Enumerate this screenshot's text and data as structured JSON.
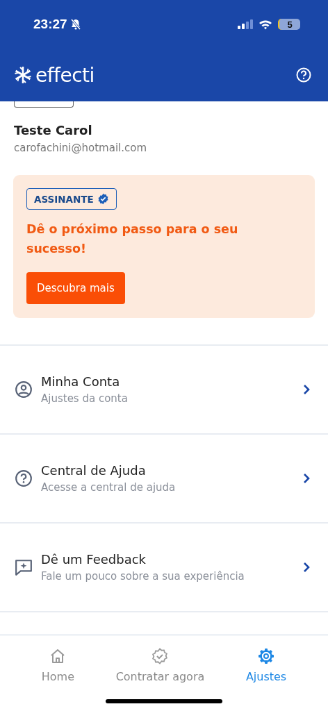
{
  "status_bar": {
    "time": "23:27",
    "battery": "5"
  },
  "app_bar": {
    "logo": "effecti"
  },
  "profile": {
    "name": "Teste Carol",
    "email": "carofachini@hotmail.com"
  },
  "promo": {
    "badge": "ASSINANTE",
    "headline": "Dê o próximo passo para o seu sucesso!",
    "button": "Descubra mais"
  },
  "menu": [
    {
      "kind": "account",
      "title": "Minha Conta",
      "subtitle": "Ajustes da conta"
    },
    {
      "kind": "help",
      "title": "Central de Ajuda",
      "subtitle": "Acesse a central de ajuda"
    },
    {
      "kind": "feedback",
      "title": "Dê um Feedback",
      "subtitle": "Fale um pouco sobre a sua experiência"
    }
  ],
  "tabs": [
    {
      "kind": "home",
      "label": "Home",
      "selected": false
    },
    {
      "kind": "badge",
      "label": "Contratar agora",
      "selected": false
    },
    {
      "kind": "settings",
      "label": "Ajustes",
      "selected": true
    }
  ]
}
